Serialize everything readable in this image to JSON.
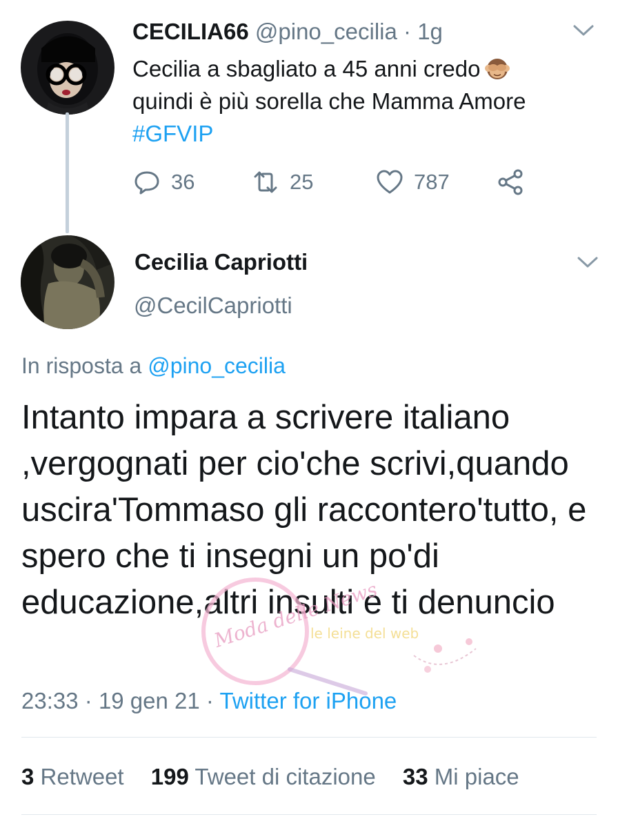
{
  "tweet1": {
    "name": "CECILIA66",
    "handle": "@pino_cecilia",
    "dot": "·",
    "time": "1g",
    "text_line1": "Cecilia a sbagliato a 45 anni credo",
    "text_line2": "quindi è più sorella che Mamma Amore",
    "hashtag": "#GFVIP",
    "emoji": "see-no-evil-monkey",
    "replies": "36",
    "retweets": "25",
    "likes": "787"
  },
  "tweet2": {
    "name": "Cecilia Capriotti",
    "handle": "@CecilCapriotti",
    "reply_prefix": "In risposta a",
    "reply_mention": "@pino_cecilia",
    "text": "Intanto impara a scrivere italiano ,vergognati per cio'che scrivi,quando uscira'Tommaso gli raccontero'tutto, e spero che ti insegni un po'di educazione,altri insulti e ti denuncio",
    "time": "23:33",
    "sep1": "·",
    "date": "19 gen 21",
    "sep2": "·",
    "source": "Twitter for iPhone"
  },
  "stats": {
    "retweets_count": "3",
    "retweets_label": "Retweet",
    "quotes_count": "199",
    "quotes_label": "Tweet di citazione",
    "likes_count": "33",
    "likes_label": "Mi piace"
  },
  "watermark": {
    "text_left": "Moda delle News",
    "text_right": "le leine del web"
  },
  "colors": {
    "link": "#1da1f2",
    "muted": "#657786",
    "text": "#14171a",
    "thread_line": "#c4d0db"
  }
}
